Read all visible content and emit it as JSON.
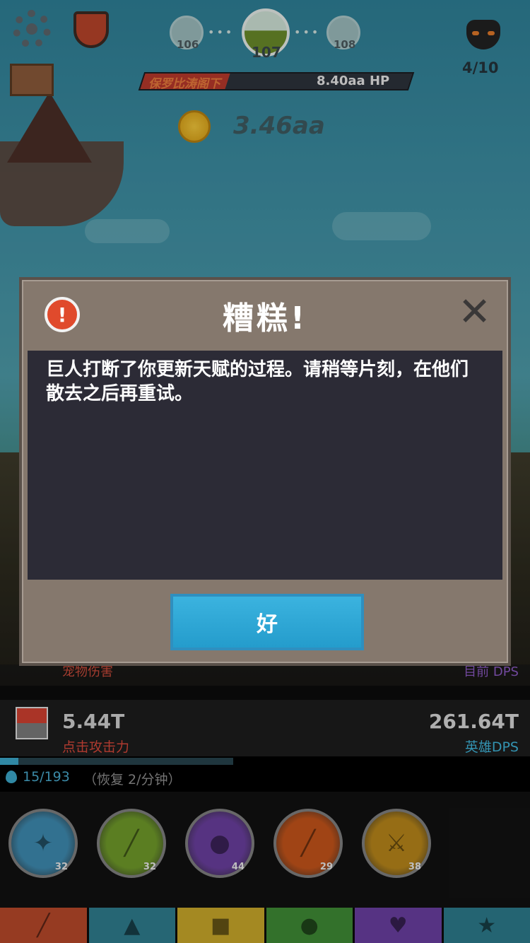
{
  "stages": {
    "prev": "106",
    "current": "107",
    "next": "108"
  },
  "boss": {
    "count": "4/10"
  },
  "enemy": {
    "name": "保罗比涛阁下",
    "hp": "8.40aa HP"
  },
  "gold": "3.46aa",
  "stats": {
    "pet_label": "宠物伤害",
    "current_dps_label": "目前 DPS",
    "tap_value": "5.44T",
    "tap_label": "点击攻击力",
    "hero_value": "261.64T",
    "hero_label": "英雄DPS"
  },
  "mana": {
    "text": "15/193",
    "regen": "（恢复 2/分钟）",
    "fill_fraction": 0.08
  },
  "skills": [
    {
      "level": "32",
      "icon": "angel-icon",
      "color": "#3e8ab0"
    },
    {
      "level": "32",
      "icon": "sword-icon",
      "color": "#6f9a2a"
    },
    {
      "level": "44",
      "icon": "crown-coin-icon",
      "color": "#6a3f9e"
    },
    {
      "level": "29",
      "icon": "blade-icon",
      "color": "#c4541a"
    },
    {
      "level": "38",
      "icon": "weapons-icon",
      "color": "#b8861a"
    }
  ],
  "tabs": [
    {
      "icon": "sword-tab-icon",
      "color": "#b8492a"
    },
    {
      "icon": "helmet-tab-icon",
      "color": "#2f7d8e"
    },
    {
      "icon": "armor-tab-icon",
      "color": "#c9a82a"
    },
    {
      "icon": "pet-tab-icon",
      "color": "#3f8a35"
    },
    {
      "icon": "clan-tab-icon",
      "color": "#6a3fa0"
    },
    {
      "icon": "star-tab-icon",
      "color": "#2c7b8b"
    }
  ],
  "dialog": {
    "title": "糟糕!",
    "message": "巨人打断了你更新天赋的过程。请稍等片刻，在他们散去之后再重试。",
    "ok_label": "好",
    "close_glyph": "✕"
  }
}
